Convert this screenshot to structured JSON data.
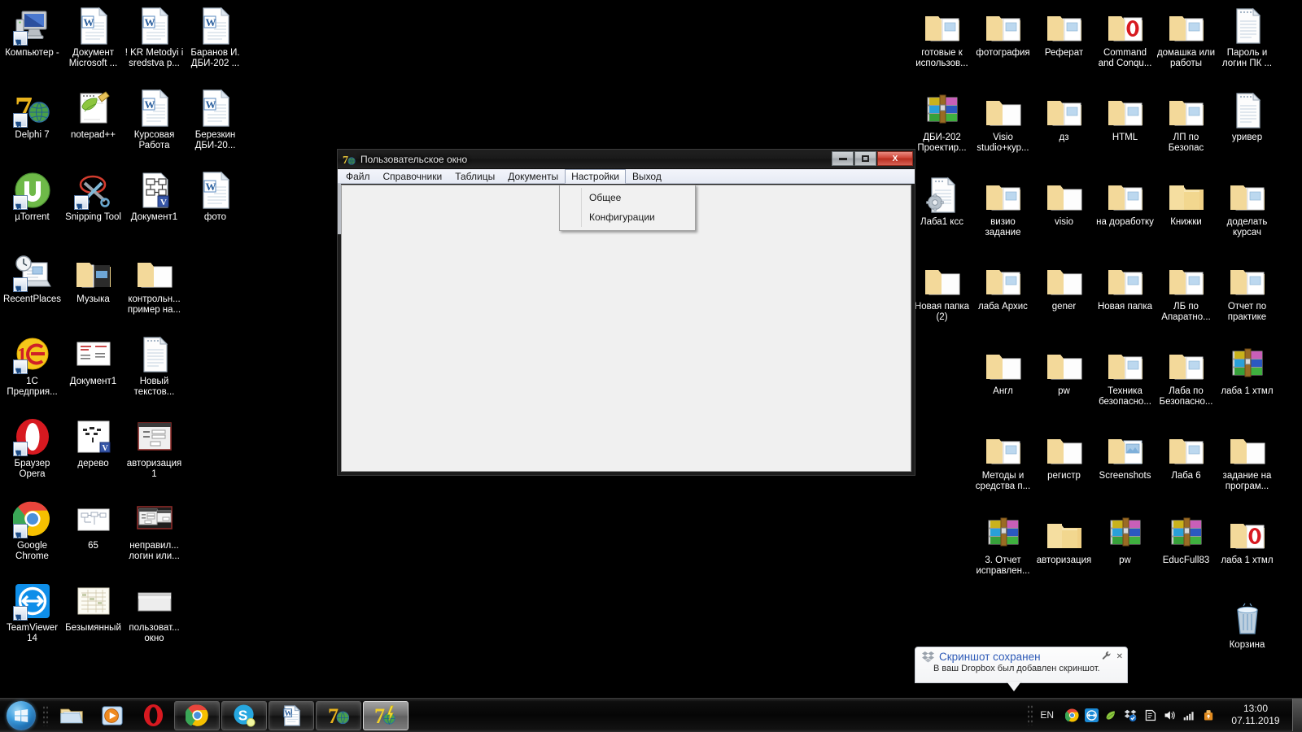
{
  "desktop": {
    "background_color": "#000000",
    "left_icons": [
      {
        "label": "Компьютер -",
        "icon": "computer-icon",
        "shortcut": true
      },
      {
        "label": "Документ Microsoft ...",
        "icon": "word-doc-icon",
        "shortcut": false
      },
      {
        "label": "! KR Metodyi i sredstva p...",
        "icon": "word-doc-icon",
        "shortcut": false
      },
      {
        "label": "Баранов И. ДБИ-202 ...",
        "icon": "word-doc-icon",
        "shortcut": false
      },
      {
        "label": "Delphi 7",
        "icon": "delphi7-icon",
        "shortcut": true
      },
      {
        "label": "notepad++",
        "icon": "notepadpp-icon",
        "shortcut": false
      },
      {
        "label": "Курсовая Работа",
        "icon": "word-doc-icon",
        "shortcut": false
      },
      {
        "label": "Березкин ДБИ-20...",
        "icon": "word-doc-icon",
        "shortcut": false
      },
      {
        "label": "µTorrent",
        "icon": "utorrent-icon",
        "shortcut": true
      },
      {
        "label": "Snipping Tool",
        "icon": "snipping-tool-icon",
        "shortcut": true
      },
      {
        "label": "Документ1",
        "icon": "visio-doc-icon",
        "shortcut": false
      },
      {
        "label": "фото",
        "icon": "word-doc-icon",
        "shortcut": false
      },
      {
        "label": "RecentPlaces",
        "icon": "recent-places-icon",
        "shortcut": true
      },
      {
        "label": "Музыка",
        "icon": "folder-music-icon",
        "shortcut": false
      },
      {
        "label": "контрольн... пример на...",
        "icon": "folder-icon",
        "shortcut": false
      },
      {
        "label": "",
        "icon": "none",
        "shortcut": false
      },
      {
        "label": "1С Предприя...",
        "icon": "1c-icon",
        "shortcut": true
      },
      {
        "label": "Документ1",
        "icon": "image-thumb-icon",
        "shortcut": false
      },
      {
        "label": "Новый текстов...",
        "icon": "text-file-icon",
        "shortcut": false
      },
      {
        "label": "",
        "icon": "none",
        "shortcut": false
      },
      {
        "label": "Браузер Opera",
        "icon": "opera-icon",
        "shortcut": true
      },
      {
        "label": "дерево",
        "icon": "visio-thumb-icon",
        "shortcut": false
      },
      {
        "label": "авторизация 1",
        "icon": "form-thumb-icon",
        "shortcut": false
      },
      {
        "label": "",
        "icon": "none",
        "shortcut": false
      },
      {
        "label": "Google Chrome",
        "icon": "chrome-icon",
        "shortcut": true
      },
      {
        "label": "65",
        "icon": "diagram-thumb-icon",
        "shortcut": false
      },
      {
        "label": "неправил... логин или...",
        "icon": "dialog-thumb-icon",
        "shortcut": false
      },
      {
        "label": "",
        "icon": "none",
        "shortcut": false
      },
      {
        "label": "TeamViewer 14",
        "icon": "teamviewer-icon",
        "shortcut": true
      },
      {
        "label": "Безымянный",
        "icon": "sheet-thumb-icon",
        "shortcut": false
      },
      {
        "label": "пользоват... окно",
        "icon": "window-thumb-icon",
        "shortcut": false
      },
      {
        "label": "",
        "icon": "none",
        "shortcut": false
      }
    ],
    "right_icons": [
      {
        "label": "готовые к использов...",
        "icon": "folder-docs-icon"
      },
      {
        "label": "фотография",
        "icon": "folder-docs-icon"
      },
      {
        "label": "Реферат",
        "icon": "folder-docs-icon"
      },
      {
        "label": "Command and Conqu...",
        "icon": "folder-opera-icon"
      },
      {
        "label": "домашка или работы",
        "icon": "folder-docs-icon"
      },
      {
        "label": "Пароль и логин ПК ...",
        "icon": "text-file-icon"
      },
      {
        "label": "ДБИ-202 Проектир...",
        "icon": "winrar-icon"
      },
      {
        "label": "Visio studio+кур...",
        "icon": "folder-icon"
      },
      {
        "label": "дз",
        "icon": "folder-docs-icon"
      },
      {
        "label": "HTML",
        "icon": "folder-docs-icon"
      },
      {
        "label": "ЛП по Безопас",
        "icon": "folder-docs-icon"
      },
      {
        "label": "уривер",
        "icon": "text-file-icon"
      },
      {
        "label": "Лаба1 ксс",
        "icon": "config-file-icon"
      },
      {
        "label": "визио задание",
        "icon": "folder-docs-icon"
      },
      {
        "label": "visio",
        "icon": "folder-icon"
      },
      {
        "label": "на доработку",
        "icon": "folder-docs-icon"
      },
      {
        "label": "Книжки",
        "icon": "folder-empty-icon"
      },
      {
        "label": "доделать курсач",
        "icon": "folder-docs-icon"
      },
      {
        "label": "Новая папка (2)",
        "icon": "folder-icon"
      },
      {
        "label": "лаба Архис",
        "icon": "folder-docs-icon"
      },
      {
        "label": "gener",
        "icon": "folder-icon"
      },
      {
        "label": "Новая папка",
        "icon": "folder-docs-icon"
      },
      {
        "label": "ЛБ по Апаратно...",
        "icon": "folder-docs-icon"
      },
      {
        "label": "Отчет по практике",
        "icon": "folder-docs-icon"
      },
      {
        "label": "",
        "icon": "none"
      },
      {
        "label": "Англ",
        "icon": "folder-icon"
      },
      {
        "label": "pw",
        "icon": "folder-icon"
      },
      {
        "label": "Техника безопасно...",
        "icon": "folder-docs-icon"
      },
      {
        "label": "Лаба по Безопасно...",
        "icon": "folder-docs-icon"
      },
      {
        "label": "лаба 1 хтмл",
        "icon": "winrar-icon"
      },
      {
        "label": "",
        "icon": "none"
      },
      {
        "label": "Методы и средства п...",
        "icon": "folder-docs-icon"
      },
      {
        "label": "регистр",
        "icon": "folder-icon"
      },
      {
        "label": "Screenshots",
        "icon": "folder-pics-icon"
      },
      {
        "label": "Лаба 6",
        "icon": "folder-docs-icon"
      },
      {
        "label": "задание на програм...",
        "icon": "folder-icon"
      },
      {
        "label": "",
        "icon": "none"
      },
      {
        "label": "3. Отчет исправлен...",
        "icon": "winrar-icon"
      },
      {
        "label": "авторизация",
        "icon": "folder-empty-icon"
      },
      {
        "label": "pw",
        "icon": "winrar-icon"
      },
      {
        "label": "EducFull83",
        "icon": "winrar-icon"
      },
      {
        "label": "лаба 1 хтмл",
        "icon": "folder-opera-icon"
      },
      {
        "label": "",
        "icon": "none"
      },
      {
        "label": "",
        "icon": "none"
      },
      {
        "label": "",
        "icon": "none"
      },
      {
        "label": "",
        "icon": "none"
      },
      {
        "label": "",
        "icon": "none"
      },
      {
        "label": "Корзина",
        "icon": "recycle-bin-icon"
      }
    ]
  },
  "window": {
    "title": "Пользовательское окно",
    "app_icon": "delphi7-icon",
    "controls": {
      "minimize": "minimize-button",
      "maximize": "maximize-button",
      "close_label": "X"
    },
    "menu": [
      {
        "label": "Файл",
        "active": false
      },
      {
        "label": "Справочники",
        "active": false
      },
      {
        "label": "Таблицы",
        "active": false
      },
      {
        "label": "Документы",
        "active": false
      },
      {
        "label": "Настройки",
        "active": true
      },
      {
        "label": "Выход",
        "active": false
      }
    ],
    "open_menu": {
      "parent": "Настройки",
      "items": [
        {
          "label": "Общее"
        },
        {
          "label": "Конфигурации"
        }
      ]
    }
  },
  "notification": {
    "title": "Скриншот сохранен",
    "body": "В ваш Dropbox был добавлен скриншот.",
    "app_icon": "dropbox-icon",
    "settings_icon": "wrench-icon",
    "close_icon": "close-icon",
    "close_label": "✕",
    "title_color": "#2f5bb7"
  },
  "taskbar": {
    "start_button": "start-orb",
    "quick_launch": [
      {
        "name": "explorer-icon",
        "state": "pinned"
      },
      {
        "name": "windows-media-player-icon",
        "state": "pinned"
      },
      {
        "name": "opera-icon",
        "state": "pinned"
      }
    ],
    "tasks": [
      {
        "name": "chrome-taskbar-button",
        "state": "running"
      },
      {
        "name": "skype-taskbar-button",
        "state": "running"
      },
      {
        "name": "word-taskbar-button",
        "state": "running"
      },
      {
        "name": "delphi7-taskbar-button",
        "state": "running"
      },
      {
        "name": "delphi7-app-taskbar-button",
        "state": "active"
      }
    ],
    "tray": {
      "language": "EN",
      "icons": [
        "chrome-tray-icon",
        "teamviewer-tray-icon",
        "notepadpp-tray-icon",
        "dropbox-tray-icon",
        "action-center-icon",
        "volume-icon",
        "network-icon",
        "safely-remove-icon"
      ],
      "time": "13:00",
      "date": "07.11.2019"
    }
  }
}
